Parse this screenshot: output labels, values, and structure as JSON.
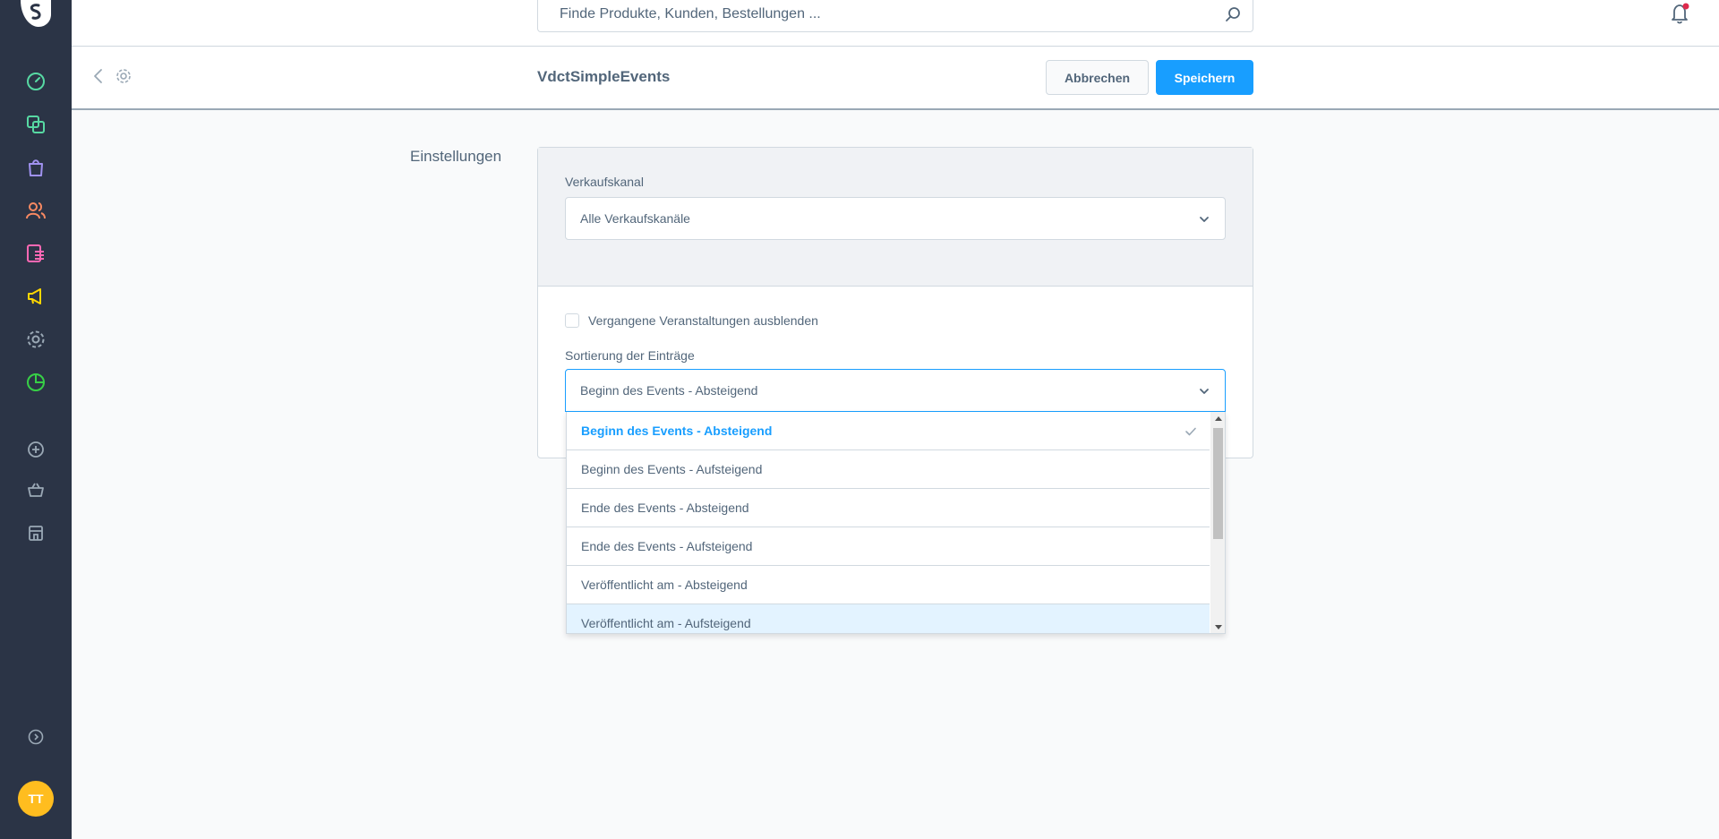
{
  "sidebar": {
    "logo": "shopware-logo",
    "nav_items": [
      {
        "name": "dashboard-icon",
        "color": "#57d9a3"
      },
      {
        "name": "catalogues-icon",
        "color": "#57d9a3"
      },
      {
        "name": "orders-icon",
        "color": "#a092f0"
      },
      {
        "name": "customers-icon",
        "color": "#f88962"
      },
      {
        "name": "content-icon",
        "color": "#ff68b4"
      },
      {
        "name": "marketing-icon",
        "color": "#ffd700"
      },
      {
        "name": "settings-icon",
        "color": "#9aa8b5"
      },
      {
        "name": "analytics-icon",
        "color": "#37d046"
      }
    ],
    "extra_items": [
      "add-extension-icon",
      "shop-icon",
      "store-icon"
    ],
    "help_icon": "question-circle-icon",
    "avatar_initials": "TT"
  },
  "header": {
    "search_placeholder": "Finde Produkte, Kunden, Bestellungen ..."
  },
  "smartbar": {
    "title": "VdctSimpleEvents",
    "cancel_label": "Abbrechen",
    "save_label": "Speichern"
  },
  "main": {
    "section_label": "Einstellungen",
    "sales_channel": {
      "label": "Verkaufskanal",
      "value": "Alle Verkaufskanäle"
    },
    "hide_past": {
      "label": "Vergangene Veranstaltungen ausblenden",
      "checked": false
    },
    "sorting": {
      "label": "Sortierung der Einträge",
      "value": "Beginn des Events - Absteigend",
      "options": [
        "Beginn des Events - Absteigend",
        "Beginn des Events - Aufsteigend",
        "Ende des Events - Absteigend",
        "Ende des Events - Aufsteigend",
        "Veröffentlicht am - Absteigend",
        "Veröffentlicht am - Aufsteigend"
      ]
    }
  },
  "colors": {
    "accent": "#189eff",
    "sidebar_bg": "#2b3446",
    "text": "#52667a",
    "border": "#d1d9e0"
  }
}
